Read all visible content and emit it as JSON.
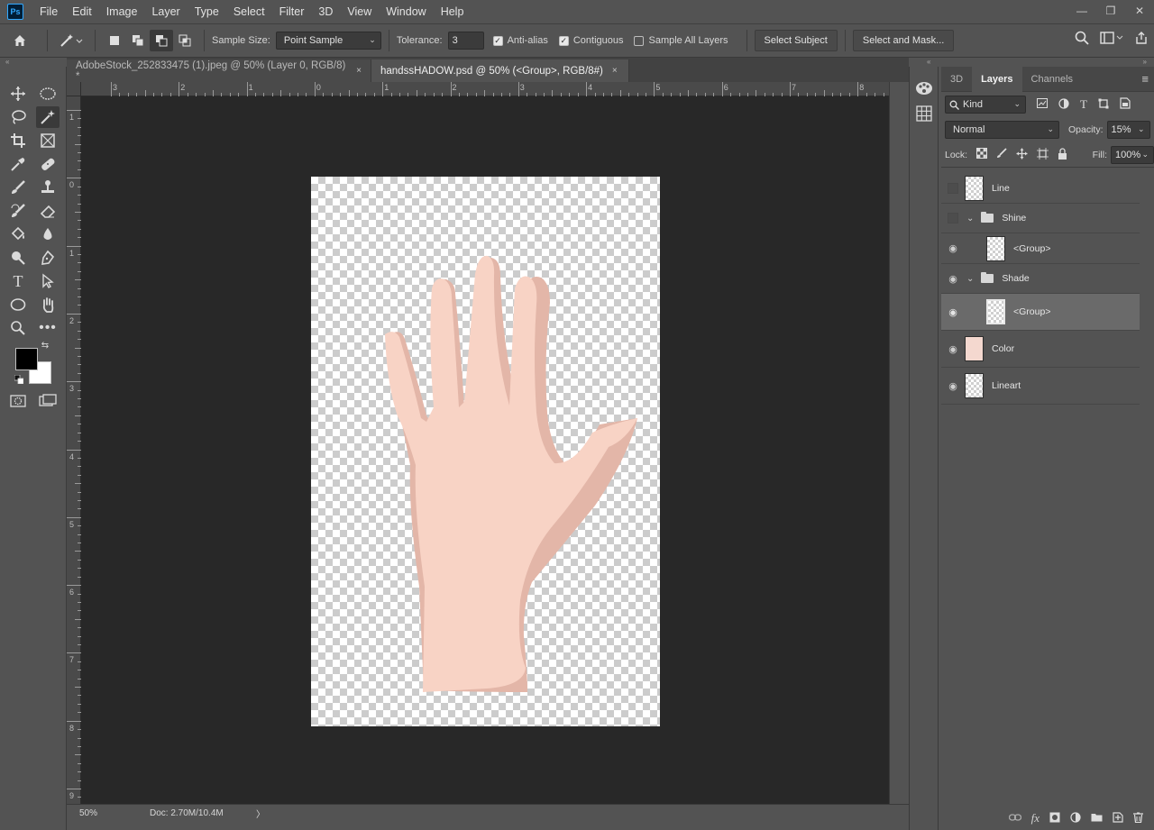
{
  "app": {
    "logo": "Ps"
  },
  "menu": [
    "File",
    "Edit",
    "Image",
    "Layer",
    "Type",
    "Select",
    "Filter",
    "3D",
    "View",
    "Window",
    "Help"
  ],
  "window_controls": {
    "minimize": "—",
    "restore": "❐",
    "close": "✕"
  },
  "options": {
    "sample_size_label": "Sample Size:",
    "sample_size_value": "Point Sample",
    "tolerance_label": "Tolerance:",
    "tolerance_value": "3",
    "anti_alias_label": "Anti-alias",
    "contiguous_label": "Contiguous",
    "sample_all_layers_label": "Sample All Layers",
    "select_subject_label": "Select Subject",
    "select_and_mask_label": "Select and Mask..."
  },
  "tabs": [
    {
      "label": "AdobeStock_252833475 (1).jpeg @ 50% (Layer 0, RGB/8) *",
      "close": "×"
    },
    {
      "label": "handssHADOW.psd @ 50% (<Group>, RGB/8#)",
      "close": "×"
    }
  ],
  "ruler": {
    "top_numbers": [
      "3",
      "2",
      "1",
      "0",
      "1",
      "2",
      "3",
      "4",
      "5",
      "6",
      "7",
      "8"
    ],
    "left_numbers": [
      "1",
      "0",
      "1",
      "2",
      "3",
      "4",
      "5",
      "6",
      "7",
      "8",
      "9"
    ]
  },
  "status": {
    "zoom": "50%",
    "doc": "Doc: 2.70M/10.4M",
    "arrow": "〉"
  },
  "layers_panel": {
    "tabs": [
      "3D",
      "Layers",
      "Channels"
    ],
    "kind_label": "Kind",
    "blend_mode": "Normal",
    "opacity_label": "Opacity:",
    "opacity_value": "15%",
    "lock_label": "Lock:",
    "fill_label": "Fill:",
    "fill_value": "100%",
    "layers": [
      {
        "name": "Line"
      },
      {
        "name": "Shine"
      },
      {
        "name": "<Group>"
      },
      {
        "name": "Shade"
      },
      {
        "name": "<Group>"
      },
      {
        "name": "Color"
      },
      {
        "name": "Lineart"
      }
    ],
    "footer_icons": [
      "link-icon",
      "fx-icon",
      "mask-icon",
      "adjustment-icon",
      "folder-icon",
      "new-layer-icon",
      "trash-icon"
    ],
    "footer_fx": "fx"
  },
  "colors": {
    "skin": "#f8d3c5",
    "shadow": "#e3b6a8",
    "canvas_bg": "#282828",
    "ui_bg": "#535353"
  }
}
